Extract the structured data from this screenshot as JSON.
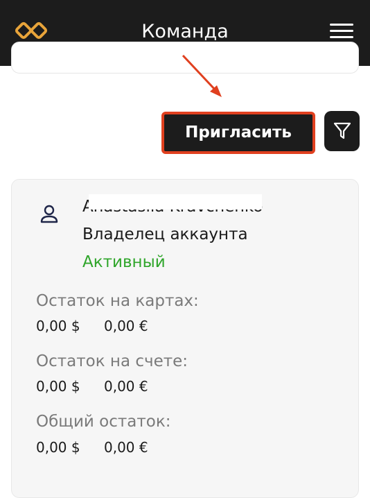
{
  "header": {
    "title": "Команда",
    "logo_icon": "infinity-logo-icon",
    "menu_icon": "hamburger-menu-icon",
    "background": "#1c1c1c",
    "logo_color": "#e8a43a"
  },
  "toolbar": {
    "invite_label": "Пригласить",
    "filter_icon": "filter-icon",
    "highlight_color": "#e0401f"
  },
  "member": {
    "name": "Anastasiia Kravchenko",
    "role": "Владелец аккаунта",
    "status": "Активный",
    "status_color": "#2fa52a",
    "avatar_icon": "user-icon"
  },
  "balances": [
    {
      "label": "Остаток на картах:",
      "usd": "0,00 $",
      "eur": "0,00 €"
    },
    {
      "label": "Остаток на счете:",
      "usd": "0,00 $",
      "eur": "0,00 €"
    },
    {
      "label": "Общий остаток:",
      "usd": "0,00 $",
      "eur": "0,00 €"
    }
  ]
}
